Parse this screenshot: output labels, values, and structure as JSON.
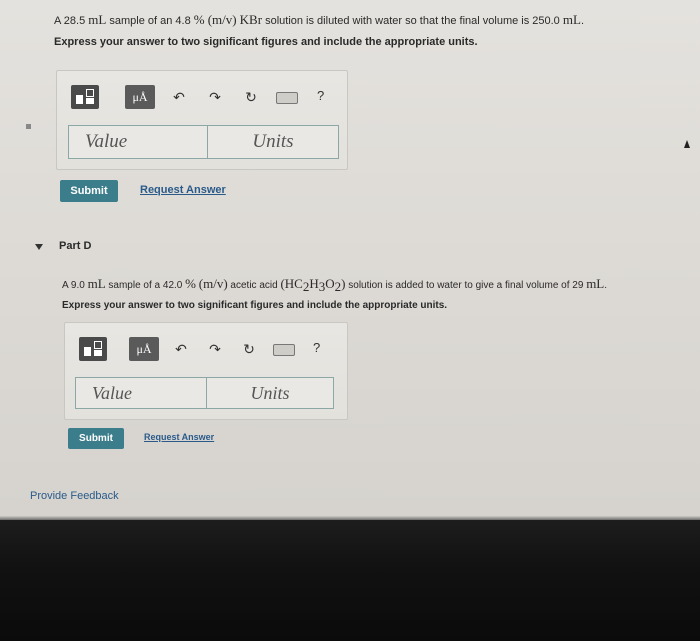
{
  "part_c": {
    "question_parts": [
      "A 28.5 ",
      "mL",
      " sample of an 4.8 ",
      "%",
      " ",
      "(m/v)",
      " ",
      "KBr",
      " solution is diluted with water so that the final volume is 250.0 ",
      "mL",
      "."
    ],
    "instruction": "Express your answer to two significant figures and include the appropriate units.",
    "value_placeholder": "Value",
    "units_placeholder": "Units",
    "submit_label": "Submit",
    "request_label": "Request Answer"
  },
  "part_d": {
    "title": "Part D",
    "question_parts": [
      "A 9.0 ",
      "mL",
      " sample of a 42.0 ",
      "%",
      " ",
      "(m/v)",
      " acetic acid ",
      "(HC",
      "2",
      "H",
      "3",
      "O",
      "2",
      ")",
      " solution is added to water to give a final volume of 29 ",
      "mL",
      "."
    ],
    "instruction": "Express your answer to two significant figures and include the appropriate units.",
    "value_placeholder": "Value",
    "units_placeholder": "Units",
    "submit_label": "Submit",
    "request_label": "Request Answer"
  },
  "toolbar": {
    "mu_label": "μÅ",
    "undo_glyph": "↶",
    "redo_glyph": "↷",
    "reset_glyph": "↻",
    "help_label": "?"
  },
  "footer": {
    "feedback_label": "Provide Feedback"
  },
  "colors": {
    "accent": "#3c7d8c",
    "link": "#2a5a8a",
    "field_border": "#8ba8a6"
  }
}
